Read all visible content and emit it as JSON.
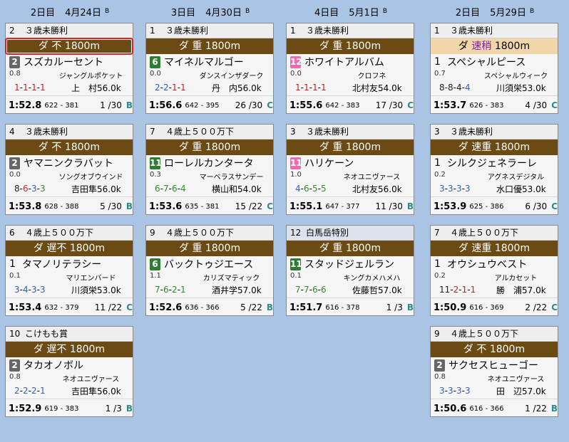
{
  "columns": [
    {
      "day": "2日目",
      "date": "4月24日",
      "tag": "B",
      "races": [
        {
          "num": "2",
          "name": "３歳未勝利",
          "cond_left": "ダ",
          "cond_mid": "不",
          "dist": "1800m",
          "selected": true,
          "horse_num": "2",
          "badge": "gray",
          "horse": "スズカルーセント",
          "odds": "0.8",
          "sire": "ジャングルポケット",
          "pos": [
            [
              "1",
              "r"
            ],
            [
              "1",
              "r"
            ],
            [
              "1",
              "r"
            ],
            [
              "1",
              "r"
            ]
          ],
          "jockey": "上　村56.0k",
          "time": "1:52.8",
          "splits": "622 - 381",
          "rank": "1 /30",
          "mark": "B"
        },
        {
          "num": "4",
          "name": "３歳未勝利",
          "cond_left": "ダ",
          "cond_mid": "不",
          "dist": "1800m",
          "horse_num": "2",
          "badge": "gray",
          "horse": "ヤマニンクラバット",
          "odds": "0.0",
          "sire": "ソングオブウインド",
          "pos": [
            [
              "8",
              "k"
            ],
            [
              "6",
              "r"
            ],
            [
              "3",
              "bl"
            ],
            [
              "3",
              "g"
            ]
          ],
          "jockey": "吉田隼56.0k",
          "time": "1:53.8",
          "splits": "628 - 388",
          "rank": "5 /30",
          "mark": "B"
        },
        {
          "num": "6",
          "name": "４歳上５００万下",
          "cond_left": "ダ",
          "cond_mid": "遅不",
          "dist": "1800m",
          "horse_num": "1",
          "badge": "none",
          "horse": "タマノリテラシー",
          "odds": "0.1",
          "sire": "マリエンバード",
          "pos": [
            [
              "3",
              "bl"
            ],
            [
              "4",
              "bl"
            ],
            [
              "3",
              "bl"
            ],
            [
              "3",
              "bl"
            ]
          ],
          "jockey": "川須栄53.0k",
          "time": "1:53.4",
          "splits": "632 - 379",
          "rank": "11 /22",
          "mark": "C"
        },
        {
          "num": "10",
          "name": "こけもも賞",
          "cond_left": "ダ",
          "cond_mid": "遅不",
          "dist": "1800m",
          "horse_num": "2",
          "badge": "gray",
          "horse": "タカオノボル",
          "odds": "0.8",
          "sire": "ネオユニヴァース",
          "pos": [
            [
              "2",
              "bl"
            ],
            [
              "2",
              "bl"
            ],
            [
              "2",
              "bl"
            ],
            [
              "1",
              "bl"
            ]
          ],
          "jockey": "吉田隼56.0k",
          "time": "1:52.9",
          "splits": "619 - 383",
          "rank": "1 /3",
          "mark": "B"
        }
      ]
    },
    {
      "day": "3日目",
      "date": "4月30日",
      "tag": "B",
      "races": [
        {
          "num": "1",
          "name": "３歳未勝利",
          "cond_left": "ダ",
          "cond_mid": "重",
          "dist": "1800m",
          "horse_num": "6",
          "badge": "green",
          "horse": "マイネルマルゴー",
          "odds": "0.0",
          "sire": "ダンスインザダーク",
          "pos": [
            [
              "2",
              "bl"
            ],
            [
              "2",
              "bl"
            ],
            [
              "1",
              "r"
            ],
            [
              "1",
              "r"
            ]
          ],
          "jockey": "丹　内56.0k",
          "time": "1:56.6",
          "splits": "642 - 395",
          "rank": "26 /30",
          "mark": "C"
        },
        {
          "num": "7",
          "name": "４歳上５００万下",
          "cond_left": "ダ",
          "cond_mid": "重",
          "dist": "1800m",
          "horse_num": "11",
          "badge": "green",
          "horse": "ローレルカンタータ",
          "odds": "0.3",
          "sire": "マーベラスサンデー",
          "pos": [
            [
              "6",
              "g"
            ],
            [
              "7",
              "g"
            ],
            [
              "6",
              "g"
            ],
            [
              "4",
              "g"
            ]
          ],
          "jockey": "横山和54.0k",
          "time": "1:53.6",
          "splits": "635 - 381",
          "rank": "15 /22",
          "mark": "C"
        },
        {
          "num": "9",
          "name": "４歳上５００万下",
          "cond_left": "ダ",
          "cond_mid": "重",
          "dist": "1800m",
          "horse_num": "6",
          "badge": "green",
          "horse": "バックトゥジエース",
          "odds": "1.1",
          "sire": "カリズマティック",
          "pos": [
            [
              "7",
              "g"
            ],
            [
              "6",
              "g"
            ],
            [
              "2",
              "g"
            ],
            [
              "1",
              "g"
            ]
          ],
          "jockey": "酒井学57.0k",
          "time": "1:52.6",
          "splits": "636 - 366",
          "rank": "5 /22",
          "mark": "B"
        }
      ]
    },
    {
      "day": "4日目",
      "date": "5月1日",
      "tag": "B",
      "races": [
        {
          "num": "1",
          "name": "３歳未勝利",
          "cond_left": "ダ",
          "cond_mid": "重",
          "dist": "1800m",
          "horse_num": "12",
          "badge": "pink",
          "horse": "ホワイトアルバム",
          "odds": "0.0",
          "sire": "クロフネ",
          "pos": [
            [
              "1",
              "r"
            ],
            [
              "1",
              "r"
            ],
            [
              "1",
              "r"
            ],
            [
              "1",
              "r"
            ]
          ],
          "jockey": "北村友54.0k",
          "time": "1:55.6",
          "splits": "642 - 383",
          "rank": "17 /30",
          "mark": "C"
        },
        {
          "num": "3",
          "name": "３歳未勝利",
          "cond_left": "ダ",
          "cond_mid": "重",
          "dist": "1800m",
          "horse_num": "11",
          "badge": "pink",
          "horse": "ハリケーン",
          "odds": "1.0",
          "sire": "ネオユニヴァース",
          "pos": [
            [
              "4",
              "bl"
            ],
            [
              "6",
              "g"
            ],
            [
              "5",
              "g"
            ],
            [
              "5",
              "g"
            ]
          ],
          "jockey": "北村友56.0k",
          "time": "1:55.1",
          "splits": "647 - 377",
          "rank": "11 /30",
          "mark": "B"
        },
        {
          "num": "12",
          "name": "白馬岳特別",
          "cond_left": "ダ",
          "cond_mid": "重",
          "dist": "1800m",
          "alt": true,
          "horse_num": "11",
          "badge": "green",
          "horse": "スタッドジェルラン",
          "odds": "0.1",
          "sire": "キングカメハメハ",
          "pos": [
            [
              "7",
              "g"
            ],
            [
              "7",
              "g"
            ],
            [
              "6",
              "g"
            ],
            [
              "6",
              "g"
            ]
          ],
          "jockey": "佐藤哲57.0k",
          "time": "1:51.7",
          "splits": "616 - 378",
          "rank": "1 /3",
          "mark": "B"
        }
      ]
    },
    {
      "day": "2日目",
      "date": "5月29日",
      "tag": "B",
      "races": [
        {
          "num": "1",
          "name": "３歳未勝利",
          "cond_left": "ダ",
          "cond_mid": "速稍",
          "dist": "1800m",
          "light": true,
          "horse_num": "1",
          "badge": "none",
          "horse": "スペシャルピース",
          "odds": "0.7",
          "sire": "スペシャルウィーク",
          "pos": [
            [
              "8",
              "k"
            ],
            [
              "8",
              "k"
            ],
            [
              "4",
              "k"
            ],
            [
              "4",
              "bl"
            ]
          ],
          "jockey": "川須栄53.0k",
          "time": "1:53.7",
          "splits": "626 - 383",
          "rank": "4 /30",
          "mark": "C"
        },
        {
          "num": "3",
          "name": "３歳未勝利",
          "cond_left": "ダ",
          "cond_mid": "速重",
          "dist": "1800m",
          "horse_num": "1",
          "badge": "none",
          "horse": "シルクジェネラーレ",
          "odds": "0.2",
          "sire": "アグネスデジタル",
          "pos": [
            [
              "3",
              "bl"
            ],
            [
              "3",
              "bl"
            ],
            [
              "3",
              "bl"
            ],
            [
              "3",
              "bl"
            ]
          ],
          "jockey": "水口優53.0k",
          "time": "1:53.9",
          "splits": "625 - 386",
          "rank": "6 /30",
          "mark": "C"
        },
        {
          "num": "7",
          "name": "４歳上５００万下",
          "cond_left": "ダ",
          "cond_mid": "速重",
          "dist": "1800m",
          "horse_num": "1",
          "badge": "none",
          "horse": "オウシュウベスト",
          "odds": "0.2",
          "sire": "アルカセット",
          "pos": [
            [
              "11",
              "k"
            ],
            [
              "2",
              "r"
            ],
            [
              "1",
              "r"
            ],
            [
              "1",
              "r"
            ]
          ],
          "jockey": "勝　浦57.0k",
          "time": "1:50.9",
          "splits": "616 - 369",
          "rank": "2 /22",
          "mark": "C"
        },
        {
          "num": "9",
          "name": "４歳上５００万下",
          "cond_left": "ダ",
          "cond_mid": "不",
          "dist": "1800m",
          "horse_num": "2",
          "badge": "gray",
          "horse": "サクセスヒューゴー",
          "odds": "0.8",
          "sire": "ネオユニヴァース",
          "pos": [
            [
              "3",
              "bl"
            ],
            [
              "3",
              "bl"
            ],
            [
              "3",
              "bl"
            ],
            [
              "3",
              "bl"
            ]
          ],
          "jockey": "田　辺57.0k",
          "time": "1:50.6",
          "splits": "616 - 366",
          "rank": "1 /22",
          "mark": "B"
        }
      ]
    }
  ]
}
